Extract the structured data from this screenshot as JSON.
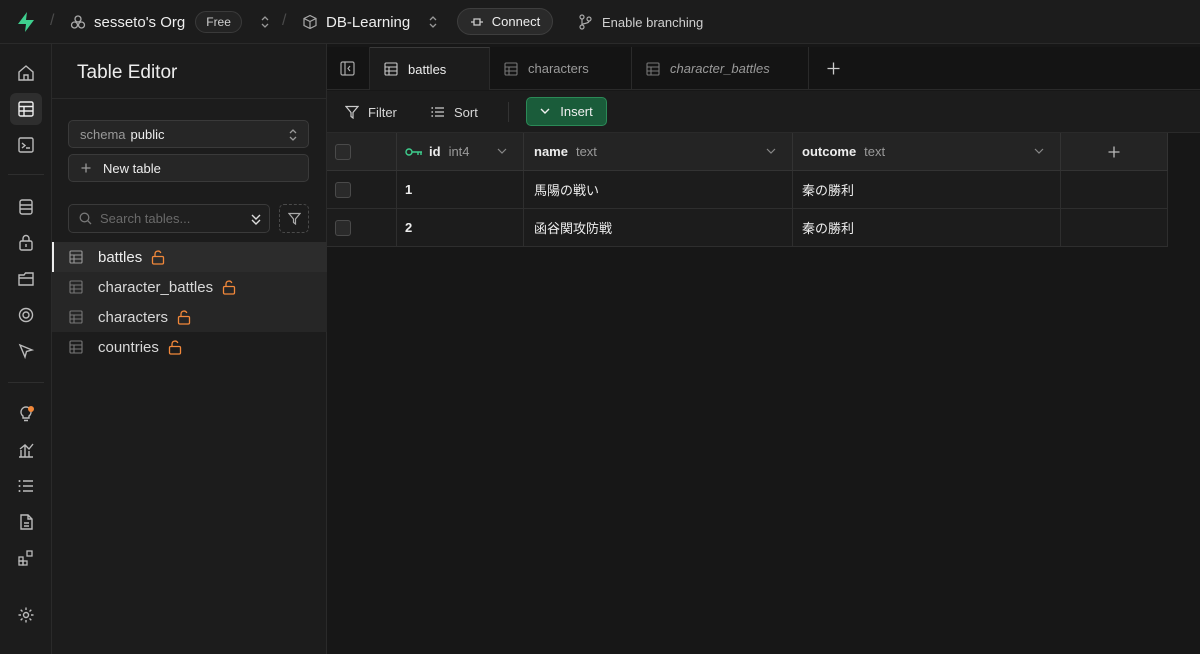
{
  "topbar": {
    "org_name": "sesseto's Org",
    "plan_badge": "Free",
    "project_name": "DB-Learning",
    "connect_label": "Connect",
    "branching_label": "Enable branching"
  },
  "sidebar": {
    "title": "Table Editor",
    "schema_label": "schema",
    "schema_value": "public",
    "new_table_label": "New table",
    "search_placeholder": "Search tables...",
    "tables": [
      {
        "name": "battles"
      },
      {
        "name": "character_battles"
      },
      {
        "name": "characters"
      },
      {
        "name": "countries"
      }
    ]
  },
  "tabs": [
    {
      "label": "battles"
    },
    {
      "label": "characters"
    },
    {
      "label": "character_battles"
    }
  ],
  "toolbar": {
    "filter_label": "Filter",
    "sort_label": "Sort",
    "insert_label": "Insert"
  },
  "grid": {
    "columns": [
      {
        "name": "id",
        "type": "int4"
      },
      {
        "name": "name",
        "type": "text"
      },
      {
        "name": "outcome",
        "type": "text"
      }
    ],
    "rows": [
      {
        "id": "1",
        "name": "馬陽の戦い",
        "outcome": "秦の勝利"
      },
      {
        "id": "2",
        "name": "函谷関攻防戦",
        "outcome": "秦の勝利"
      }
    ]
  },
  "colors": {
    "accent_green": "#3ecf8e",
    "lock_orange": "#f2883a",
    "insert_bg": "#1a5c3a"
  }
}
